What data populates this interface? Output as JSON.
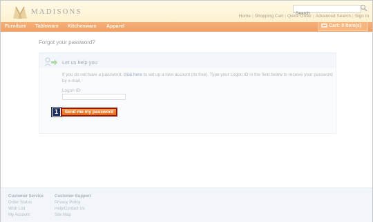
{
  "header": {
    "logo_text": "MADISONS",
    "search_placeholder": "Search",
    "links": [
      "Home",
      "Shopping Cart",
      "Quick Order",
      "Advanced Search",
      "Sign In"
    ]
  },
  "nav": {
    "items": [
      "Furniture",
      "Tableware",
      "Kitchenware",
      "Apparel"
    ],
    "cart_label": "Cart: 0 Item(s)"
  },
  "main": {
    "page_title": "Forgot your password?",
    "help_title": "Let us help you",
    "help_text_before": "If you do not have a password, ",
    "help_link": "click here",
    "help_text_after": " to set up a new account (its free). Type your Logon ID in the field below to receive your password by e-mail.",
    "logon_label": "Logon ID:",
    "logon_value": "",
    "step_number": "1",
    "send_button": "Send me my password"
  },
  "footer": {
    "col1": {
      "head": "Customer Service",
      "items": [
        "Order Status",
        "Wish List",
        "My Account"
      ]
    },
    "col2": {
      "head": "Customer Support",
      "items": [
        "Privacy Policy",
        "Help/Contact Us",
        "Site Map"
      ]
    }
  },
  "colors": {
    "nav_bg": "#f19f63",
    "button_bg": "#e96a1d",
    "button_border": "#8b1a0f",
    "step_badge": "#1b2f5c"
  }
}
